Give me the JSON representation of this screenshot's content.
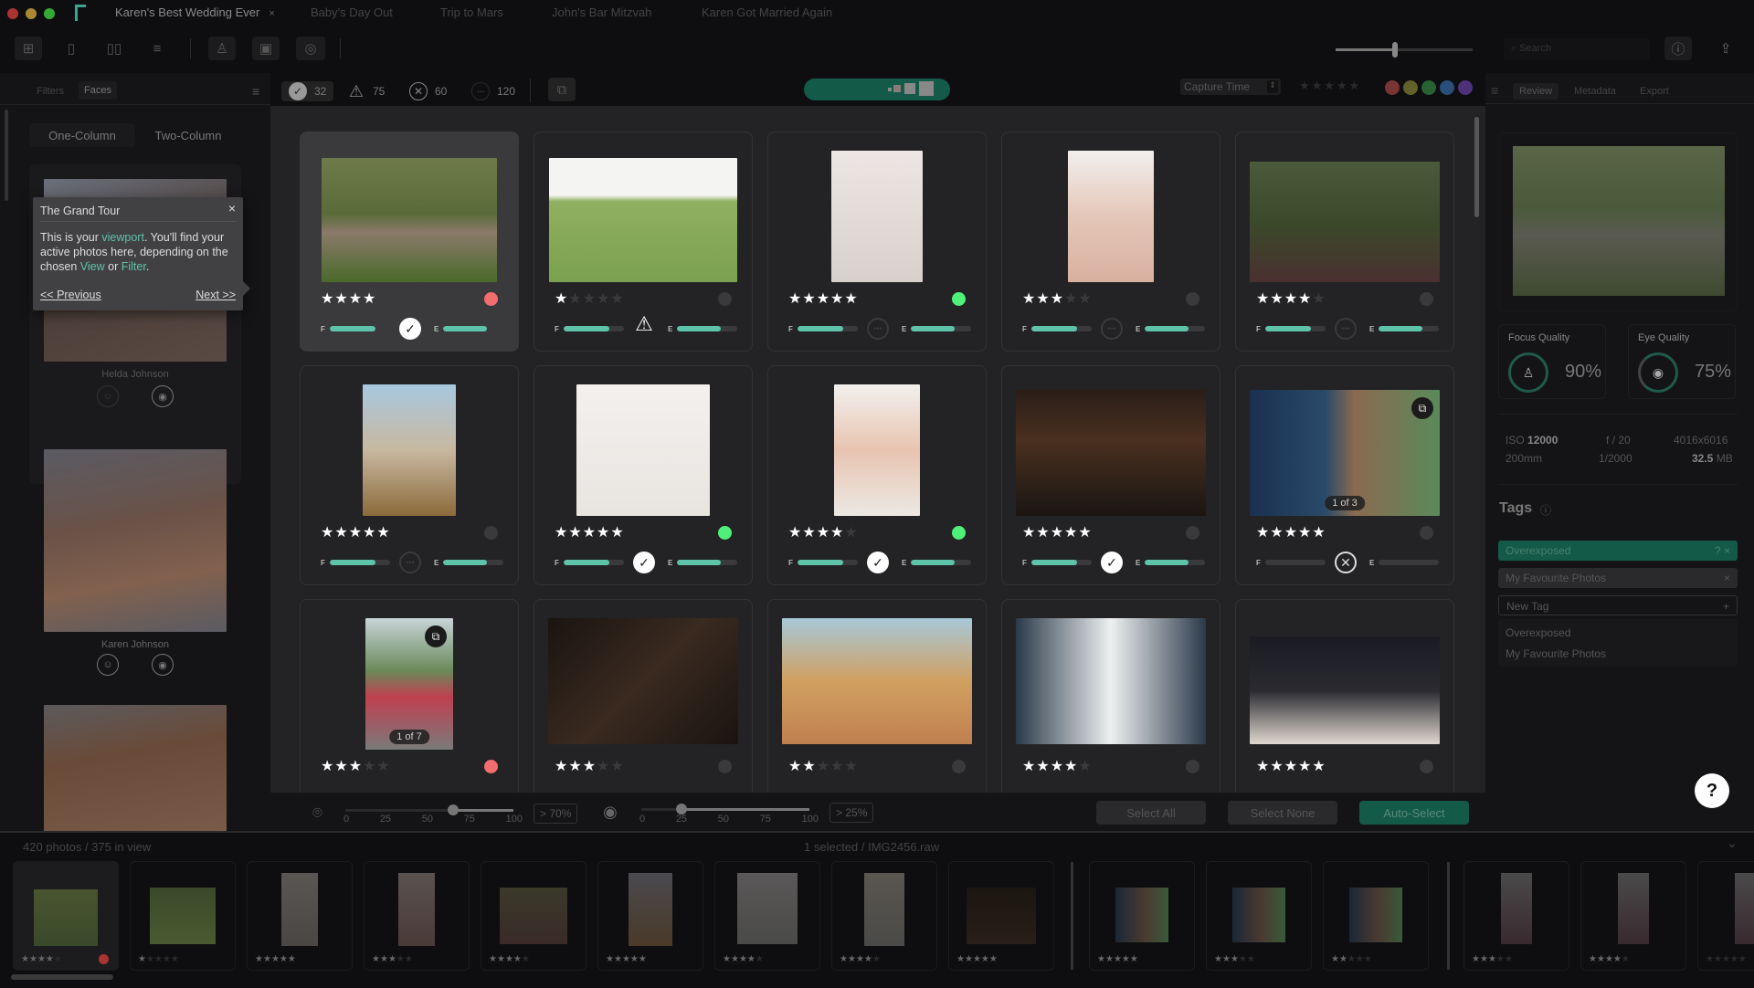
{
  "window": {
    "tabs": [
      {
        "label": "Karen's Best Wedding Ever",
        "active": true
      },
      {
        "label": "Baby's Day Out"
      },
      {
        "label": "Trip to Mars"
      },
      {
        "label": "John's Bar Mitzvah"
      },
      {
        "label": "Karen Got Married Again"
      }
    ],
    "close_glyph": "×"
  },
  "toolbar": {
    "search_placeholder": "Search",
    "zoom_slider_value": 0.43
  },
  "left_panel": {
    "tabs": [
      "Filters",
      "Faces"
    ],
    "active_tab": "Faces",
    "column_toggle": [
      "One-Column",
      "Two-Column"
    ],
    "faces": [
      {
        "name": "Helda Johnson"
      },
      {
        "name": "Karen Johnson"
      },
      {
        "name": ""
      }
    ]
  },
  "tour": {
    "title": "The Grand Tour",
    "text_1": "This is your ",
    "link_1": "viewport",
    "text_2": ". You'll find your active photos here, depending on the chosen ",
    "link_2": "View",
    "text_3": " or ",
    "link_3": "Filter",
    "text_4": ".",
    "prev": "<< Previous",
    "next": "Next >>"
  },
  "filter_bar": {
    "accepted_count": "32",
    "warning_count": "75",
    "rejected_count": "60",
    "undecided_count": "120",
    "sort_label": "Capture Time",
    "color_labels": [
      "#c0504d",
      "#9a9a3a",
      "#3a9a4a",
      "#3a7ac0",
      "#7a4ac0"
    ]
  },
  "grid": {
    "photos": [
      {
        "stars": 4,
        "dot": "#f26d6d",
        "status": "ok",
        "focus": 0.75,
        "eye": 0.72,
        "selected": true
      },
      {
        "stars": 1,
        "dot": "",
        "status": "warn",
        "focus": 0.75,
        "eye": 0.72
      },
      {
        "stars": 5,
        "dot": "#4ff07a",
        "status": "more",
        "focus": 0.75,
        "eye": 0.72
      },
      {
        "stars": 3,
        "dot": "",
        "status": "more",
        "focus": 0.75,
        "eye": 0.72
      },
      {
        "stars": 4,
        "dot": "",
        "status": "more",
        "focus": 0.75,
        "eye": 0.72
      },
      {
        "stars": 5,
        "dot": "",
        "status": "more",
        "focus": 0.75,
        "eye": 0.72
      },
      {
        "stars": 5,
        "dot": "#4ff07a",
        "status": "ok",
        "focus": 0.75,
        "eye": 0.72
      },
      {
        "stars": 4,
        "dot": "#4ff07a",
        "status": "ok",
        "focus": 0.75,
        "eye": 0.72
      },
      {
        "stars": 5,
        "dot": "",
        "status": "ok",
        "focus": 0.75,
        "eye": 0.72
      },
      {
        "stars": 5,
        "dot": "",
        "status": "x",
        "focus": 0,
        "eye": 0,
        "stack": "1 of 3"
      },
      {
        "stars": 3,
        "dot": "#f26d6d",
        "status": "",
        "stack": "1 of 7"
      },
      {
        "stars": 3,
        "dot": "",
        "status": ""
      },
      {
        "stars": 2,
        "dot": "",
        "status": ""
      },
      {
        "stars": 4,
        "dot": "",
        "status": ""
      },
      {
        "stars": 5,
        "dot": "",
        "status": ""
      }
    ],
    "focus_label": "F",
    "eye_label": "E"
  },
  "bottom_bar": {
    "focus_ticks": [
      "0",
      "25",
      "50",
      "75",
      "100"
    ],
    "focus_threshold": "> 70%",
    "eye_ticks": [
      "0",
      "25",
      "50",
      "75",
      "100"
    ],
    "eye_threshold": "> 25%",
    "select_all": "Select All",
    "select_none": "Select None",
    "auto_select": "Auto-Select"
  },
  "right_panel": {
    "tabs": [
      "Review",
      "Metadata",
      "Export"
    ],
    "active_tab": "Review",
    "focus_quality_label": "Focus Quality",
    "focus_quality_value": "90%",
    "eye_quality_label": "Eye Quality",
    "eye_quality_value": "75%",
    "iso_label": "ISO",
    "iso_value": "12000",
    "aperture": "f / 20",
    "dimensions": "4016x6016",
    "focal_length": "200mm",
    "shutter": "1/2000",
    "size_value": "32.5",
    "size_unit": "MB",
    "tags_title": "Tags",
    "tags": [
      {
        "label": "Overexposed",
        "active": true,
        "actions": "? ×"
      },
      {
        "label": "My Favourite Photos",
        "actions": "×"
      }
    ],
    "new_tag_placeholder": "New Tag",
    "suggestions": [
      "Overexposed",
      "My Favourite Photos"
    ]
  },
  "status": {
    "count_text": "420 photos / 375 in view",
    "selection_text": "1 selected / IMG2456.raw"
  },
  "filmstrip": [
    {
      "stars": 4,
      "dot": true
    },
    {
      "stars": 1
    },
    {
      "stars": 5
    },
    {
      "stars": 3
    },
    {
      "stars": 4
    },
    {
      "stars": 5
    },
    {
      "stars": 4
    },
    {
      "stars": 4
    },
    {
      "stars": 5
    },
    {
      "stars": 5
    },
    {
      "stars": 3
    },
    {
      "stars": 2
    },
    {
      "stars": 3
    },
    {
      "stars": 4
    },
    {
      "stars": 0
    }
  ],
  "help_label": "?"
}
